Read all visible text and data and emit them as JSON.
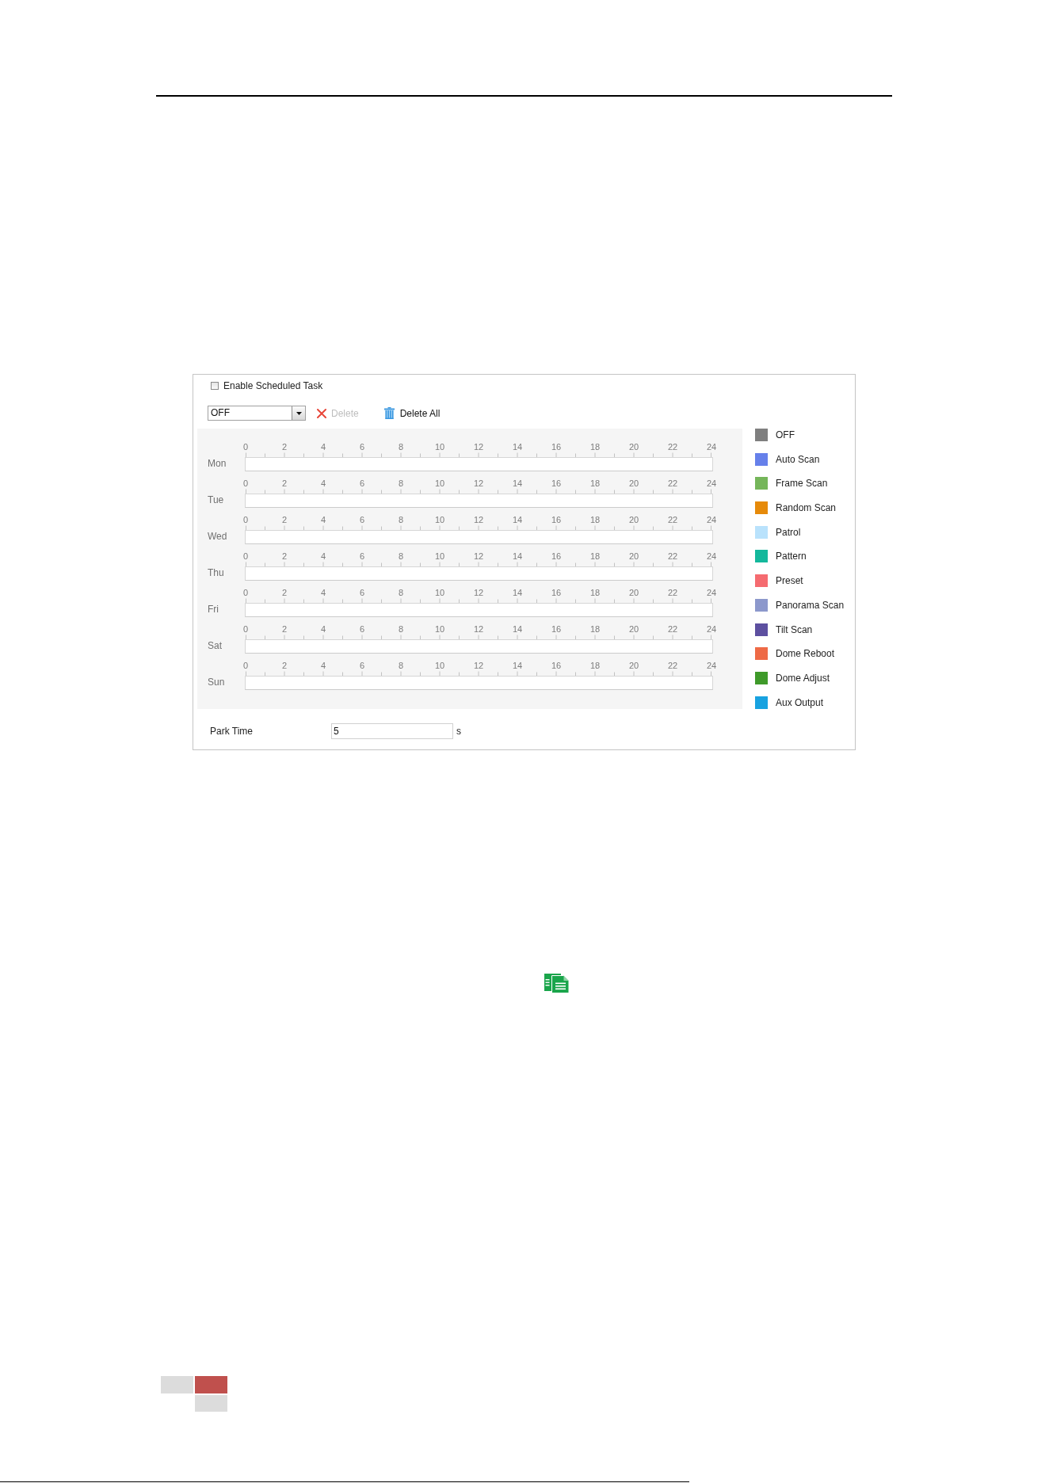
{
  "enable_scheduled_task": {
    "label": "Enable Scheduled Task",
    "checked": false
  },
  "task_dropdown": {
    "value": "OFF"
  },
  "toolbar": [
    {
      "kind": "delete",
      "label": "Delete",
      "disabled": true
    },
    {
      "kind": "delete_all",
      "label": "Delete All",
      "disabled": false
    }
  ],
  "days": [
    {
      "label": "Mon",
      "scale": [
        "0",
        "2",
        "4",
        "6",
        "8",
        "10",
        "12",
        "14",
        "16",
        "18",
        "20",
        "22",
        "24"
      ]
    },
    {
      "label": "Tue",
      "scale": [
        "0",
        "2",
        "4",
        "6",
        "8",
        "10",
        "12",
        "14",
        "16",
        "18",
        "20",
        "22",
        "24"
      ]
    },
    {
      "label": "Wed",
      "scale": [
        "0",
        "2",
        "4",
        "6",
        "8",
        "10",
        "12",
        "14",
        "16",
        "18",
        "20",
        "22",
        "24"
      ]
    },
    {
      "label": "Thu",
      "scale": [
        "0",
        "2",
        "4",
        "6",
        "8",
        "10",
        "12",
        "14",
        "16",
        "18",
        "20",
        "22",
        "24"
      ]
    },
    {
      "label": "Fri",
      "scale": [
        "0",
        "2",
        "4",
        "6",
        "8",
        "10",
        "12",
        "14",
        "16",
        "18",
        "20",
        "22",
        "24"
      ]
    },
    {
      "label": "Sat",
      "scale": [
        "0",
        "2",
        "4",
        "6",
        "8",
        "10",
        "12",
        "14",
        "16",
        "18",
        "20",
        "22",
        "24"
      ]
    },
    {
      "label": "Sun",
      "scale": [
        "0",
        "2",
        "4",
        "6",
        "8",
        "10",
        "12",
        "14",
        "16",
        "18",
        "20",
        "22",
        "24"
      ]
    }
  ],
  "legend": [
    {
      "label": "OFF",
      "color": "#7f7f7f"
    },
    {
      "label": "Auto Scan",
      "color": "#6680ea"
    },
    {
      "label": "Frame Scan",
      "color": "#75b65a"
    },
    {
      "label": "Random Scan",
      "color": "#e68a0a"
    },
    {
      "label": "Patrol",
      "color": "#b9e2fc"
    },
    {
      "label": "Pattern",
      "color": "#14b89c"
    },
    {
      "label": "Preset",
      "color": "#f56b70"
    },
    {
      "label": "Panorama Scan",
      "color": "#8c98cc"
    },
    {
      "label": "Tilt Scan",
      "color": "#5d50a0"
    },
    {
      "label": "Dome Reboot",
      "color": "#ee6a46"
    },
    {
      "label": "Dome Adjust",
      "color": "#3f9a2a"
    },
    {
      "label": "Aux Output",
      "color": "#18a2e0"
    }
  ],
  "park_time": {
    "label": "Park Time",
    "value": "5",
    "unit": "s"
  }
}
